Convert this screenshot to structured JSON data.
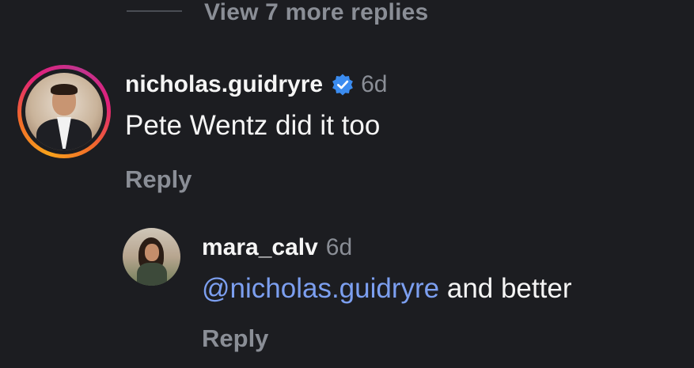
{
  "thread": {
    "view_more_label": "View 7 more replies"
  },
  "comments": [
    {
      "username": "nicholas.guidryre",
      "verified": true,
      "time": "6d",
      "text": "Pete Wentz did it too",
      "reply_label": "Reply"
    },
    {
      "username": "mara_calv",
      "verified": false,
      "time": "6d",
      "mention": "@nicholas.guidryre",
      "text": " and better",
      "reply_label": "Reply"
    }
  ],
  "colors": {
    "background": "#1c1d21",
    "mention": "#7c9ff0",
    "verified_badge": "#3b8cf0",
    "muted_text": "#8a8e96"
  }
}
